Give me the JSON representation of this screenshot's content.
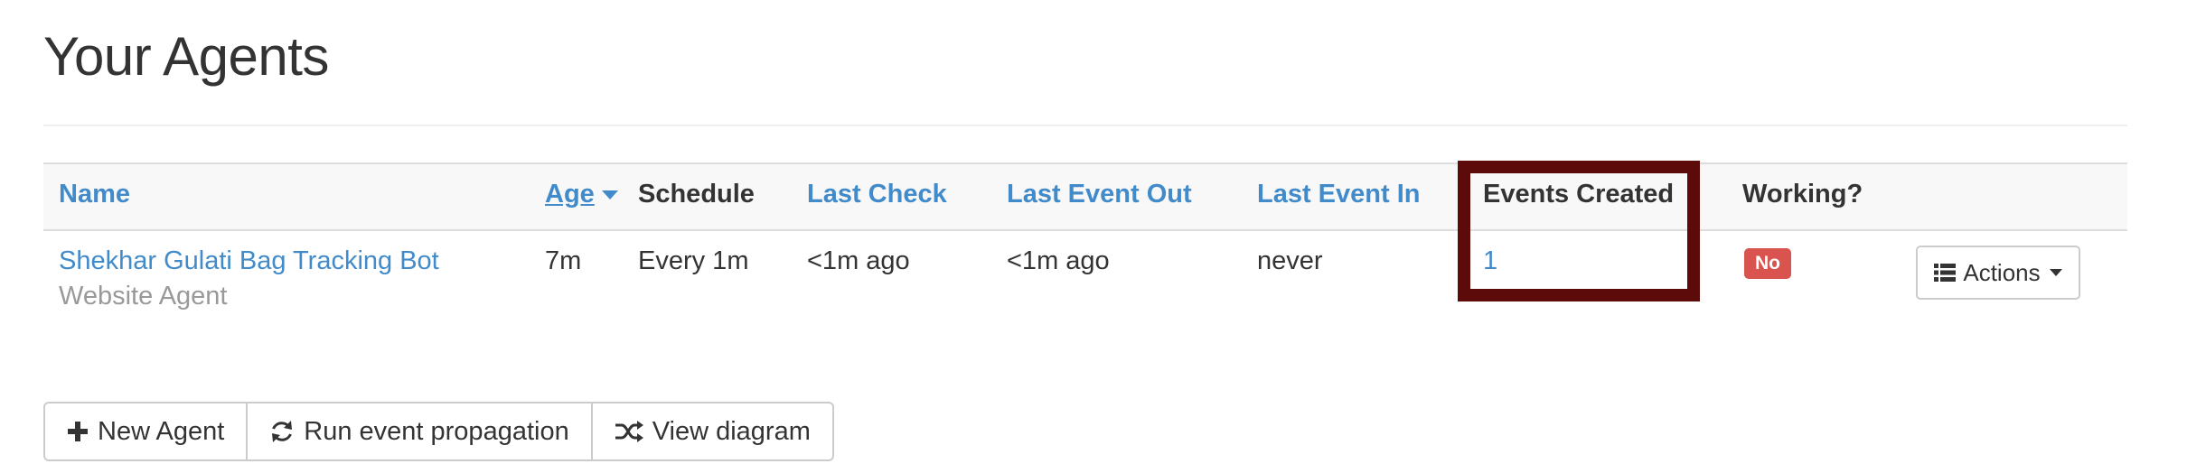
{
  "page": {
    "title": "Your Agents"
  },
  "table": {
    "headers": {
      "name": "Name",
      "age": "Age",
      "schedule": "Schedule",
      "last_check": "Last Check",
      "last_event_out": "Last Event Out",
      "last_event_in": "Last Event In",
      "events_created": "Events Created",
      "working": "Working?"
    },
    "rows": [
      {
        "name": "Shekhar Gulati Bag Tracking Bot",
        "type": "Website Agent",
        "age": "7m",
        "schedule": "Every 1m",
        "last_check": "<1m ago",
        "last_event_out": "<1m ago",
        "last_event_in": "never",
        "events_created": "1",
        "working": "No",
        "actions_label": "Actions"
      }
    ]
  },
  "buttons": {
    "new_agent": "New Agent",
    "run_event_propagation": "Run event propagation",
    "view_diagram": "View diagram"
  },
  "colors": {
    "link": "#428bca",
    "danger": "#d9534f",
    "highlight_border": "#5c0a0a"
  },
  "icons": {
    "sort": "caret-down-icon",
    "actions": "list-icon",
    "new_agent": "plus-icon",
    "run": "refresh-icon",
    "diagram": "random-icon"
  }
}
